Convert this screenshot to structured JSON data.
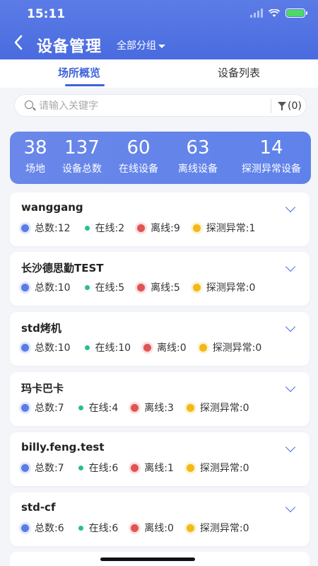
{
  "status": {
    "time": "15:11"
  },
  "nav": {
    "title": "设备管理",
    "group_select": "全部分组"
  },
  "tabs": [
    {
      "label": "场所概览",
      "active": true
    },
    {
      "label": "设备列表",
      "active": false
    }
  ],
  "search": {
    "placeholder": "请输入关键字",
    "filter_label": "(0)"
  },
  "summary": [
    {
      "value": "38",
      "label": "场地"
    },
    {
      "value": "137",
      "label": "设备总数"
    },
    {
      "value": "60",
      "label": "在线设备"
    },
    {
      "value": "63",
      "label": "离线设备"
    },
    {
      "value": "14",
      "label": "探测异常设备"
    }
  ],
  "sites": [
    {
      "name": "wanggang",
      "total": "总数:12",
      "online": "在线:2",
      "offline": "离线:9",
      "abnormal": "探测异常:1"
    },
    {
      "name": "长沙德思勤TEST",
      "total": "总数:10",
      "online": "在线:5",
      "offline": "离线:5",
      "abnormal": "探测异常:0"
    },
    {
      "name": "std烤机",
      "total": "总数:10",
      "online": "在线:10",
      "offline": "离线:0",
      "abnormal": "探测异常:0"
    },
    {
      "name": "玛卡巴卡",
      "total": "总数:7",
      "online": "在线:4",
      "offline": "离线:3",
      "abnormal": "探测异常:0"
    },
    {
      "name": "billy.feng.test",
      "total": "总数:7",
      "online": "在线:6",
      "offline": "离线:1",
      "abnormal": "探测异常:0"
    },
    {
      "name": "std-cf",
      "total": "总数:6",
      "online": "在线:6",
      "offline": "离线:0",
      "abnormal": "探测异常:0"
    }
  ],
  "colors": {
    "primary": "#4a6bdf",
    "online": "#2bbf8a",
    "offline": "#e15454",
    "abnormal": "#f3b915"
  }
}
